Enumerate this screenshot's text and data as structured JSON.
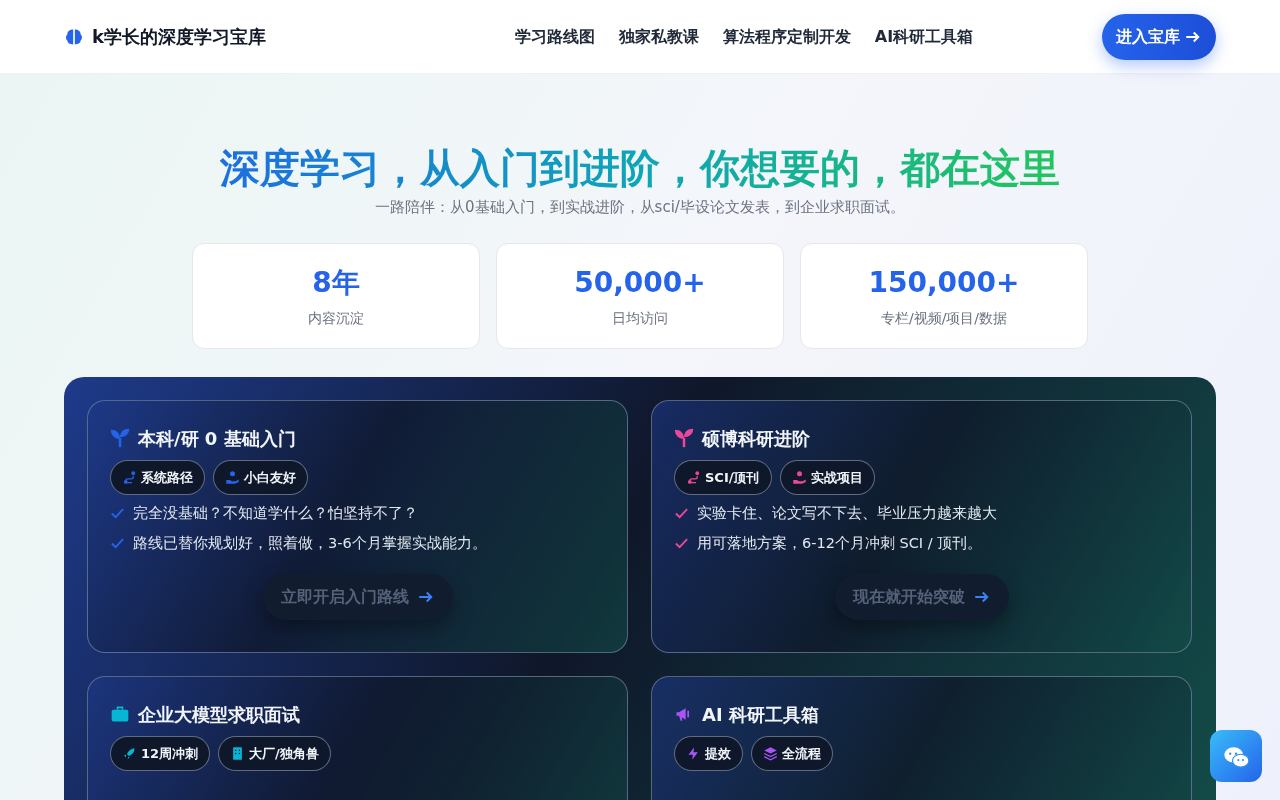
{
  "navbar": {
    "brand": "k学长的深度学习宝库",
    "links": [
      "学习路线图",
      "独家私教课",
      "算法程序定制开发",
      "AI科研工具箱"
    ],
    "cta": "进入宝库"
  },
  "hero": {
    "title": "深度学习，从入门到进阶，你想要的，都在这里",
    "subtitle": "一路陪伴：从0基础入门，到实战进阶，从sci/毕设论文发表，到企业求职面试。"
  },
  "stats": [
    {
      "value": "8年",
      "label": "内容沉淀"
    },
    {
      "value": "50,000+",
      "label": "日均访问"
    },
    {
      "value": "150,000+",
      "label": "专栏/视频/项目/数据"
    }
  ],
  "cards": [
    {
      "color": "#2563eb",
      "title": "本科/研 0 基础入门",
      "tags": [
        "系统路径",
        "小白友好"
      ],
      "points": [
        "完全没基础？不知道学什么？怕坚持不了？",
        "路线已替你规划好，照着做，3-6个月掌握实战能力。"
      ],
      "button": "立即开启入门路线"
    },
    {
      "color": "#ec4899",
      "title": "硕博科研进阶",
      "tags": [
        "SCI/顶刊",
        "实战项目"
      ],
      "points": [
        "实验卡住、论文写不下去、毕业压力越来越大",
        "用可落地方案，6-12个月冲刺 SCI / 顶刊。"
      ],
      "button": "现在就开始突破"
    },
    {
      "color": "#06b6d4",
      "title": "企业大模型求职面试",
      "tags": [
        "12周冲刺",
        "大厂/独角兽"
      ]
    },
    {
      "color": "#a855f7",
      "title": "AI 科研工具箱",
      "tags": [
        "提效",
        "全流程"
      ]
    }
  ]
}
